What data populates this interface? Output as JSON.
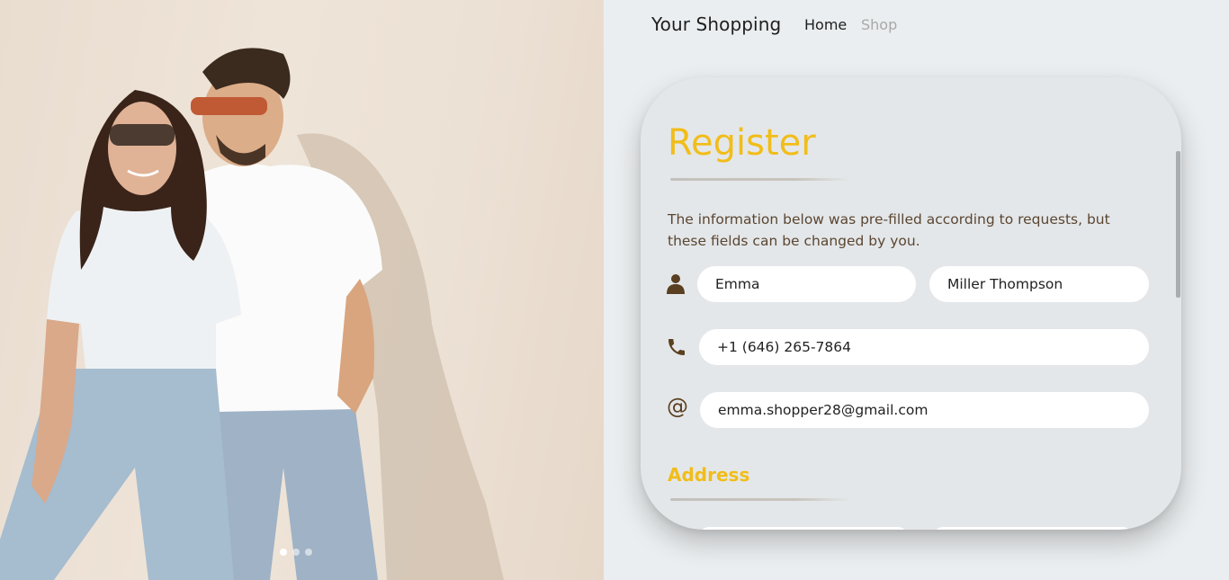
{
  "nav": {
    "brand": "Your Shopping",
    "home": "Home",
    "shop": "Shop"
  },
  "carousel": {
    "slide_count": 3,
    "active_index": 0
  },
  "register": {
    "title": "Register",
    "description": "The information below was pre-filled according to requests, but these fields can be changed by you.",
    "first_name": "Emma",
    "last_name": "Miller Thompson",
    "phone": "+1 (646) 265-7864",
    "email": "emma.shopper28@gmail.com",
    "email_symbol": "@",
    "address_heading": "Address"
  },
  "colors": {
    "accent": "#f1bd1a",
    "text_brown": "#5a4632",
    "icon_brown": "#5a3f20",
    "page_bg": "#ebeef0",
    "card_bg": "#e4e7e9"
  },
  "icons": {
    "name": "user-icon",
    "phone": "phone-icon",
    "email": "at-icon"
  }
}
